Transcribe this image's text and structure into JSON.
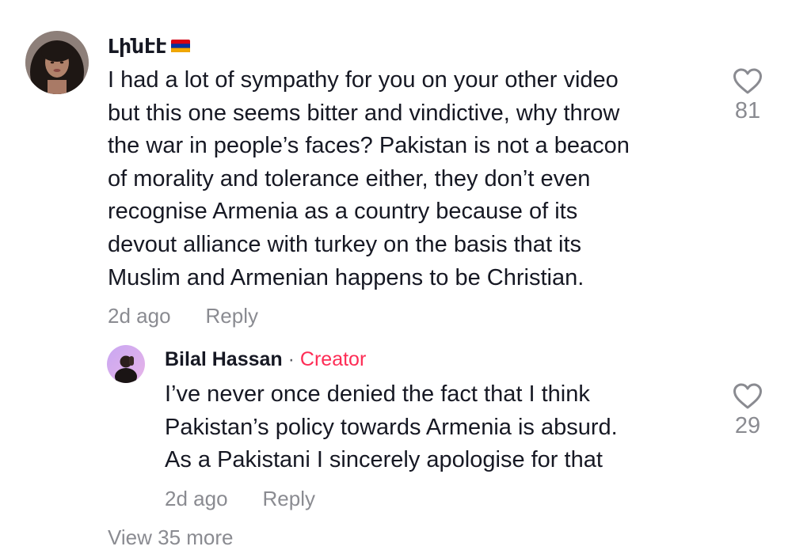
{
  "comment": {
    "username": "Լինէէ",
    "flag_icon": "armenia-flag-icon",
    "text": "I had a lot of sympathy for you on your other video\nbut this one seems bitter and vindictive, why throw\nthe war in people’s faces? Pakistan is not a beacon\nof morality and tolerance either, they don’t even\nrecognise Armenia as a country because of its\ndevout alliance with turkey on the basis that its\nMuslim and Armenian happens to be Christian.",
    "time": "2d ago",
    "reply_label": "Reply",
    "like_icon": "heart-outline-icon",
    "like_count": "81"
  },
  "reply": {
    "username": "Bilal Hassan",
    "separator": " · ",
    "creator_label": "Creator",
    "text": "I’ve never once denied the fact that I think\nPakistan’s policy towards Armenia is absurd.\nAs a Pakistani I sincerely apologise for that",
    "time": "2d ago",
    "reply_label": "Reply",
    "like_icon": "heart-outline-icon",
    "like_count": "29"
  },
  "view_more_label": "View 35 more",
  "colors": {
    "text": "#161823",
    "secondary": "#8a8b91",
    "creator": "#fe2c55",
    "background": "#ffffff"
  }
}
